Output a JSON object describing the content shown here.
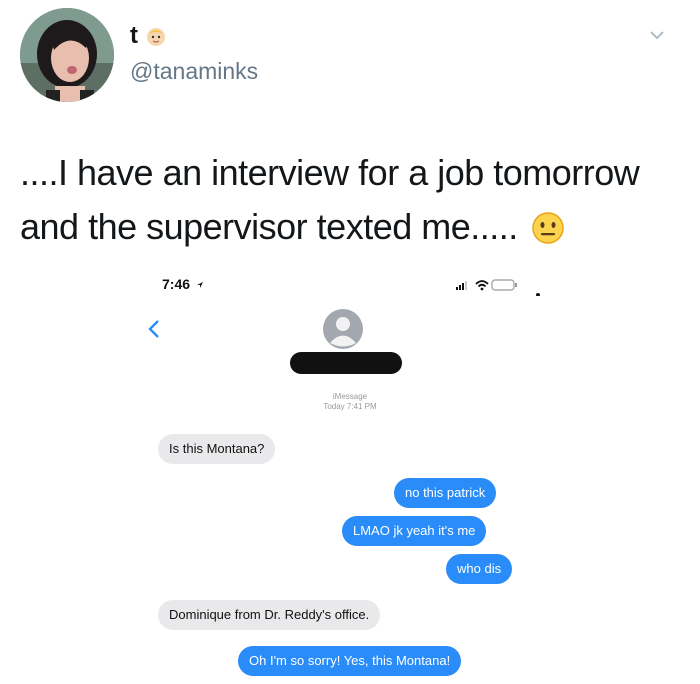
{
  "tweet": {
    "display_name": "t",
    "handle": "@tanaminks",
    "text": "....I have an interview for a job tomorrow and the supervisor texted me....."
  },
  "phone": {
    "time": "7:46",
    "service_label": "iMessage",
    "timestamp": "Today 7:41 PM",
    "messages": [
      {
        "from": "them",
        "text": "Is this Montana?"
      },
      {
        "from": "me",
        "text": "no this patrick"
      },
      {
        "from": "me",
        "text": "LMAO jk yeah it's me"
      },
      {
        "from": "me",
        "text": "who dis"
      },
      {
        "from": "them",
        "text": "Dominique from Dr. Reddy's office."
      },
      {
        "from": "me",
        "text": "Oh I'm so sorry! Yes, this Montana!"
      }
    ]
  },
  "colors": {
    "imessage_blue": "#2a8cf8",
    "incoming_gray": "#e9e9eb",
    "handle_gray": "#657786"
  },
  "icons": [
    "baby-emoji",
    "neutral-face-emoji",
    "chevron-down-icon",
    "back-chevron-icon",
    "contact-avatar-icon",
    "signal-icon",
    "wifi-icon",
    "battery-icon",
    "location-arrow-icon"
  ]
}
